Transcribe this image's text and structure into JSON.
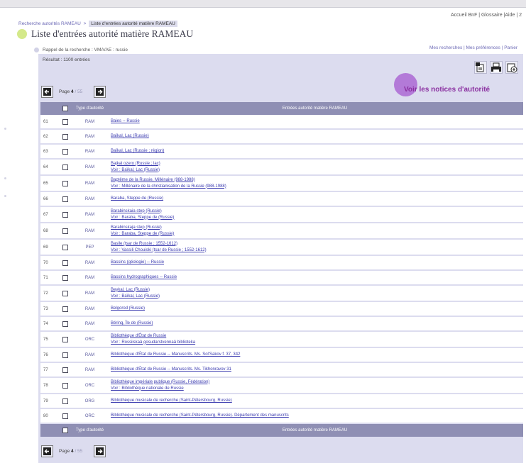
{
  "top_links": "Accueil BnF | Glossaire |Aide | 2",
  "breadcrumb": {
    "link": "Recherche autorités RAMEAU",
    "separator": ">",
    "current": "Liste d'entrées autorité matière RAMEAU"
  },
  "page_title": "Liste d'entrées autorité matière RAMEAU",
  "rappel": "Rappel de la recherche : VMA/AE : russie",
  "user_links": "Mes recherches | Mes préférences | Panier",
  "resultat": "Résultat : 1100 entrées",
  "voir_notices": "Voir les notices d'autorité",
  "pager": {
    "label": "Page",
    "current": "4",
    "total": "/ 55",
    "total_bottom": "/ 55"
  },
  "table": {
    "col_type": "Type d'autorité",
    "col_entries": "Entrées autorité matière RAMEAU",
    "rows": [
      {
        "num": "61",
        "type": "RAM",
        "l1": "Baies -- Russie",
        "l2": ""
      },
      {
        "num": "62",
        "type": "RAM",
        "l1": "Baïkal, Lac (Russie)",
        "l2": ""
      },
      {
        "num": "63",
        "type": "RAM",
        "l1": "Baïkal, Lac (Russie ; région)",
        "l2": ""
      },
      {
        "num": "64",
        "type": "RAM",
        "l1": "Bajkal ozero (Russie ; lac)",
        "l2": "Voir : Baïkal, Lac (Russie)"
      },
      {
        "num": "65",
        "type": "RAM",
        "l1": "Baptême de la Russie, Millénaire (988-1988)",
        "l2": "Voir : Millénaire de la christianisation de la Russie (988-1988)"
      },
      {
        "num": "66",
        "type": "RAM",
        "l1": "Baraba, Steppe de (Russie)",
        "l2": ""
      },
      {
        "num": "67",
        "type": "RAM",
        "l1": "Barabinskaia step (Russie)",
        "l2": "Voir : Baraba, Steppe de (Russie)"
      },
      {
        "num": "68",
        "type": "RAM",
        "l1": "Barabinskaja step (Russie)",
        "l2": "Voir : Baraba, Steppe de (Russie)"
      },
      {
        "num": "69",
        "type": "PEP",
        "l1": "Basile (tsar de Russie ; 1552-1612)",
        "l2": "Voir : Vassili Chouiski (tsar de Russie ; 1552-1612)"
      },
      {
        "num": "70",
        "type": "RAM",
        "l1": "Bassins (géologie) -- Russie",
        "l2": ""
      },
      {
        "num": "71",
        "type": "RAM",
        "l1": "Bassins hydrographiques -- Russie",
        "l2": ""
      },
      {
        "num": "72",
        "type": "RAM",
        "l1": "Beykal, Lac (Russie)",
        "l2": "Voir : Baïkal, Lac (Russie)"
      },
      {
        "num": "73",
        "type": "RAM",
        "l1": "Belgorod (Russie)",
        "l2": ""
      },
      {
        "num": "74",
        "type": "RAM",
        "l1": "Béring, Île de (Russie)",
        "l2": ""
      },
      {
        "num": "75",
        "type": "ORC",
        "l1": "Bibliothèque d'État de Russie",
        "l2": "Voir : Rossiiskaâ gosudarstvennaâ biblioteka"
      },
      {
        "num": "76",
        "type": "RAM",
        "l1": "Bibliothèque d'État de Russie -- Manuscrits. Ms. Sol'Sakov f. 37, 342",
        "l2": ""
      },
      {
        "num": "77",
        "type": "RAM",
        "l1": "Bibliothèque d'État de Russie -- Manuscrits. Ms. Tikhonravov 31",
        "l2": ""
      },
      {
        "num": "78",
        "type": "ORC",
        "l1": "Bibliothèque impériale publique (Russie, Fédération)",
        "l2": "Voir : Bibliothèque nationale de Russie"
      },
      {
        "num": "79",
        "type": "ORG",
        "l1": "Bibliothèque musicale de recherche (Saint-Pétersbourg, Russie)",
        "l2": ""
      },
      {
        "num": "80",
        "type": "ORC",
        "l1": "Bibliothèque musicale de recherche (Saint-Pétersbourg, Russie). Département des manuscrits",
        "l2": ""
      }
    ]
  },
  "icons": {
    "prev": "prev-page-icon",
    "next": "next-page-icon",
    "export": "export-icon",
    "print": "print-icon",
    "email": "email-icon"
  },
  "colors": {
    "panel": "#dcdcef",
    "header": "#8f8fb4",
    "link": "#3b3bb0",
    "voir": "#8a2fa0"
  }
}
